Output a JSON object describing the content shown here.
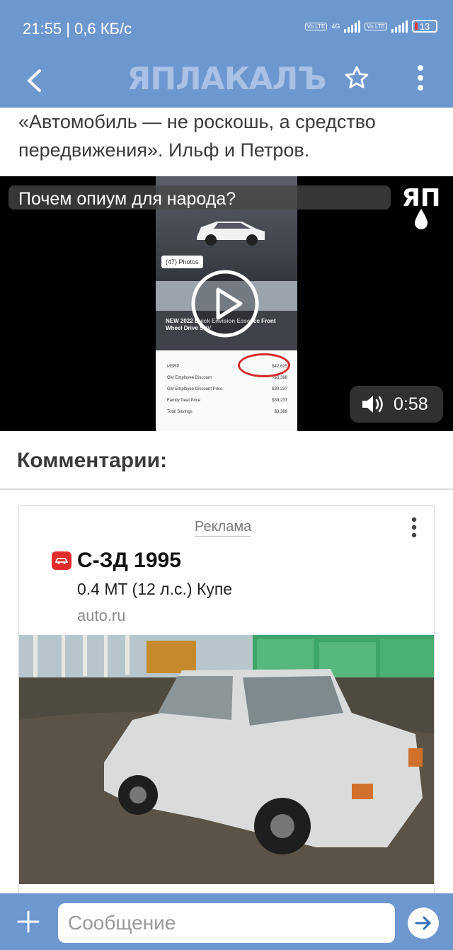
{
  "status_bar": {
    "time": "21:55",
    "speed": "| 0,6 КБ/с",
    "volte_label": "Vo LTE",
    "network_label": "4G",
    "battery": "13"
  },
  "header": {
    "logo_text": "ЯПЛАКАЛЪ",
    "colors": {
      "bar": "#6d98cf",
      "logo": "#a8c1e4"
    }
  },
  "post": {
    "quote": "«Автомобиль — не роскошь, а средство передвижения». Ильф и Петров."
  },
  "video": {
    "title": "Почем опиум для народа?",
    "logo": "ЯП",
    "duration": "0:58",
    "frame": {
      "photos_label": "(47) Photos",
      "car_title": "NEW 2022 Buick Envision Essence Front Wheel Drive SUV",
      "rows": [
        {
          "label": "MSRP",
          "value": "$42,625"
        },
        {
          "label": "GM Employee Discount",
          "value": "-$3,388"
        },
        {
          "label": "GM Employee Discount Price",
          "value": "$39,237"
        },
        {
          "label": "Family Deal Price",
          "value": "$39,237"
        },
        {
          "label": "Total Savings",
          "value": "$3,388"
        }
      ]
    }
  },
  "comments": {
    "title": "Комментарии:"
  },
  "ad": {
    "label": "Реклама",
    "title": "С-ЗД 1995",
    "subtitle": "0.4 MT (12 л.с.) Купе",
    "domain": "auto.ru",
    "icon_color": "#e32d2d"
  },
  "composer": {
    "placeholder": "Сообщение"
  }
}
